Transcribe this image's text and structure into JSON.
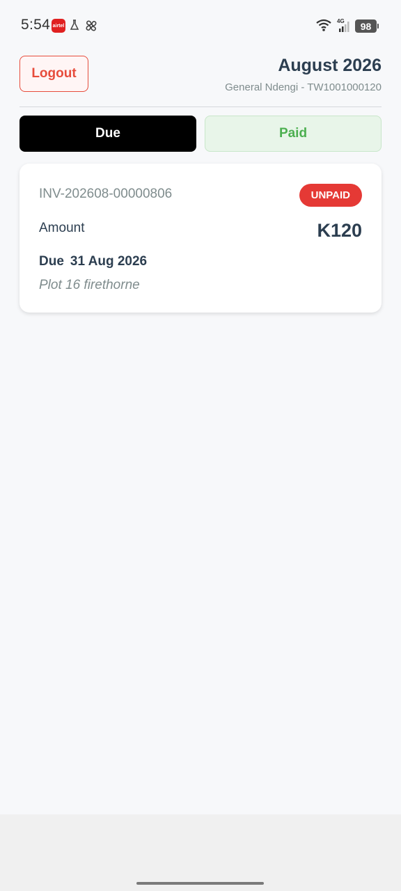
{
  "status_bar": {
    "time": "5:54",
    "app_icon_text": "airtel",
    "network": "4G",
    "battery": "98"
  },
  "header": {
    "logout_label": "Logout",
    "month_title": "August 2026",
    "account_line": "General Ndengi - TW1001000120"
  },
  "tabs": [
    {
      "label": "Due",
      "active": true
    },
    {
      "label": "Paid",
      "active": false
    }
  ],
  "invoice": {
    "number": "INV-202608-00000806",
    "status": "UNPAID",
    "amount_label": "Amount",
    "amount_value": "K120",
    "due_label": "Due",
    "due_date": "31 Aug 2026",
    "plot": "Plot 16 firethorne"
  },
  "colors": {
    "accent_red": "#e74c3c",
    "badge_red": "#e53935",
    "paid_green": "#4caf50",
    "text_dark": "#2c3e50",
    "text_muted": "#7f8c8d"
  }
}
